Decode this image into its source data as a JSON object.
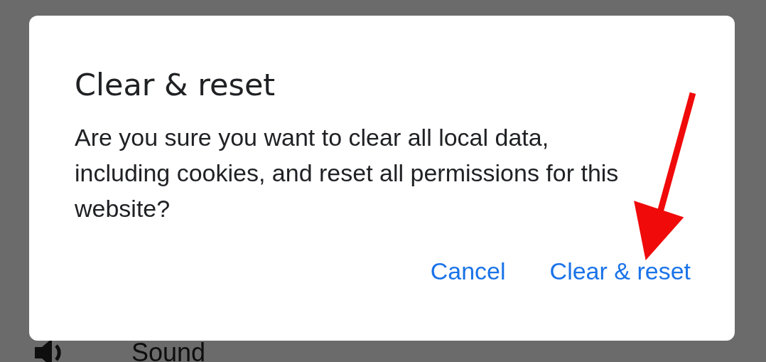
{
  "background": {
    "items": [
      {
        "label": "Sound"
      }
    ]
  },
  "dialog": {
    "title": "Clear & reset",
    "message": "Are you sure you want to clear all local data, including cookies, and reset all permissions for this website?",
    "buttons": [
      {
        "label": "Cancel"
      },
      {
        "label": "Clear & reset"
      }
    ]
  }
}
